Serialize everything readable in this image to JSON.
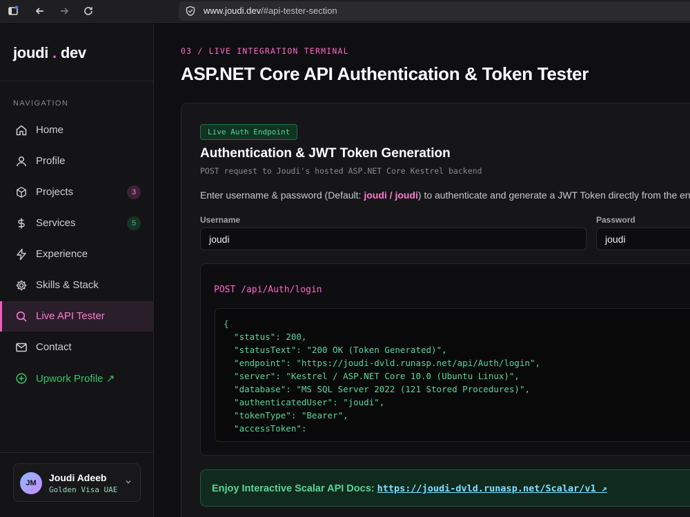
{
  "browser": {
    "url_domain": "www.joudi.dev",
    "url_path": "/#api-tester-section"
  },
  "sidebar": {
    "logo": {
      "left": "joudi",
      "dot": ".",
      "right": "dev"
    },
    "nav_caption": "NAVIGATION",
    "items": [
      {
        "label": "Home",
        "icon": "home-icon"
      },
      {
        "label": "Profile",
        "icon": "user-icon"
      },
      {
        "label": "Projects",
        "icon": "cube-icon",
        "count": "3"
      },
      {
        "label": "Services",
        "icon": "dollar-icon",
        "count": "5"
      },
      {
        "label": "Experience",
        "icon": "lightning-icon"
      },
      {
        "label": "Skills & Stack",
        "icon": "gear-icon"
      },
      {
        "label": "Live API Tester",
        "icon": "search-icon",
        "active": true
      },
      {
        "label": "Contact",
        "icon": "mail-icon"
      },
      {
        "label": "Upwork Profile ↗",
        "icon": "plus-circle-icon"
      }
    ],
    "profile": {
      "initials": "JM",
      "name": "Joudi Adeeb",
      "subtitle": "Golden Visa UAE"
    }
  },
  "main": {
    "eyebrow": "03 / LIVE INTEGRATION TERMINAL",
    "title": "ASP.NET Core API Authentication & Token Tester",
    "panel": {
      "badge": "Live Auth Endpoint",
      "section_title": "Authentication & JWT Token Generation",
      "section_subtitle": "POST request to Joudi's hosted ASP.NET Core Kestrel backend",
      "instruction_before": "Enter username & password (Default: ",
      "instruction_highlight": "joudi / joudi",
      "instruction_after": ") to authenticate and generate a JWT Token directly from the end",
      "username_label": "Username",
      "username_value": "joudi",
      "password_label": "Password",
      "password_value": "joudi",
      "endpoint": "POST /api/Auth/login",
      "response_lines": [
        "{",
        "  \"status\": 200,",
        "  \"statusText\": \"200 OK (Token Generated)\",",
        "  \"endpoint\": \"https://joudi-dvld.runasp.net/api/Auth/login\",",
        "  \"server\": \"Kestrel / ASP.NET Core 10.0 (Ubuntu Linux)\",",
        "  \"database\": \"MS SQL Server 2022 (121 Stored Procedures)\",",
        "  \"authenticatedUser\": \"joudi\",",
        "  \"tokenType\": \"Bearer\",",
        "  \"accessToken\":"
      ],
      "docs_text": "Enjoy Interactive Scalar API Docs: ",
      "docs_link": "https://joudi-dvld.runasp.net/Scalar/v1 ↗"
    }
  },
  "colors": {
    "accent_pink": "#ff66cc",
    "accent_green": "#55d695",
    "link": "#7ee0ff"
  }
}
